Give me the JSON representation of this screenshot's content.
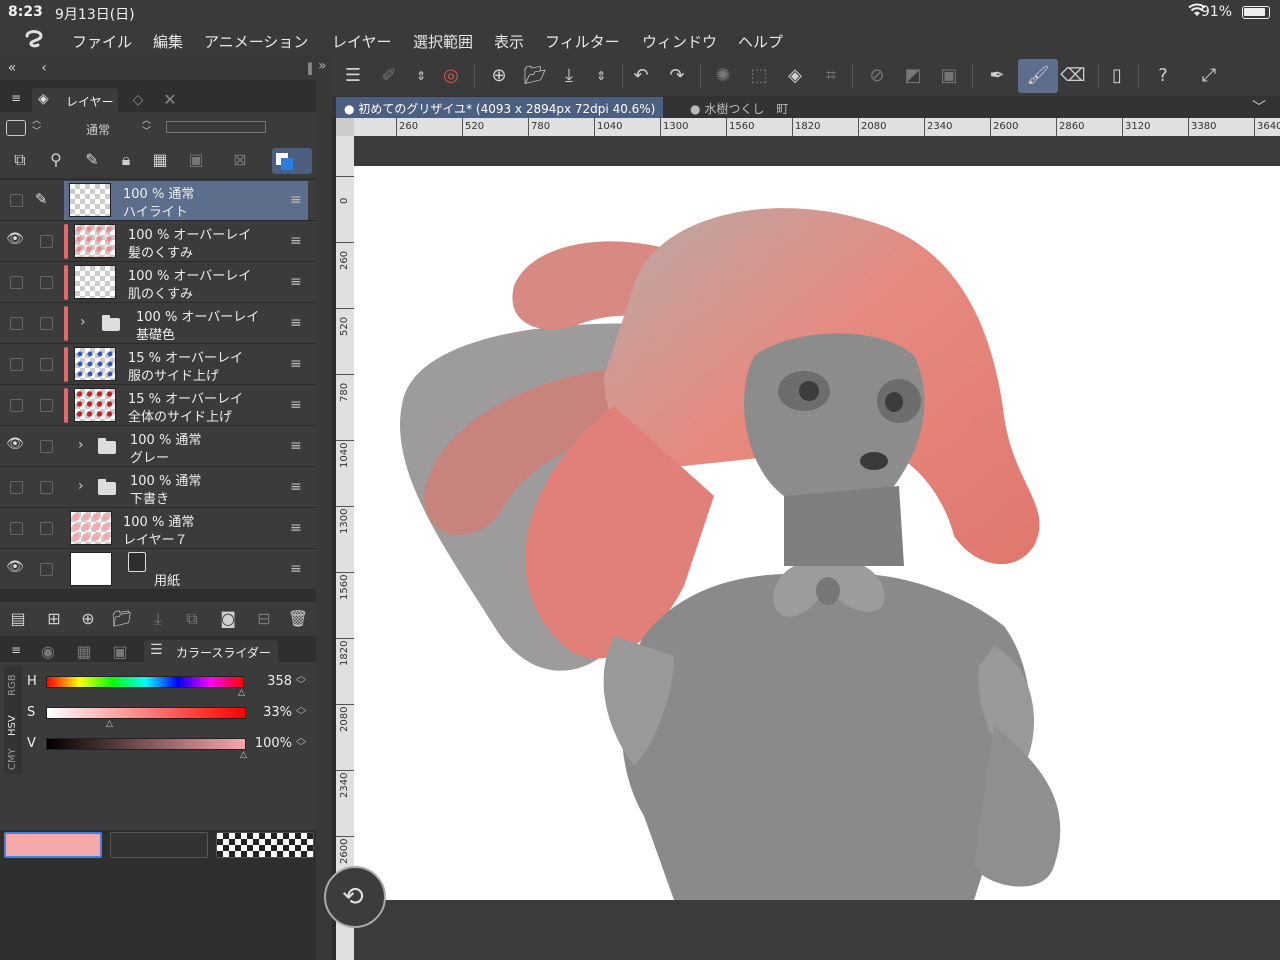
{
  "status_bar": {
    "time": "8:23",
    "date": "9月13日(日)",
    "battery": "91%"
  },
  "menu": {
    "items": [
      "ファイル",
      "編集",
      "アニメーション",
      "レイヤー",
      "選択範囲",
      "表示",
      "フィルター",
      "ウィンドウ",
      "ヘルプ"
    ]
  },
  "layer_panel": {
    "tab_label": "レイヤー",
    "blend_mode": "通常",
    "layers": [
      {
        "opacity_mode": "100 % 通常",
        "name": "ハイライト",
        "visible": false,
        "selected": true
      },
      {
        "opacity_mode": "100 % オーバーレイ",
        "name": "髪のくすみ",
        "visible": true,
        "selected": false
      },
      {
        "opacity_mode": "100 % オーバーレイ",
        "name": "肌のくすみ",
        "visible": false,
        "selected": false
      },
      {
        "opacity_mode": "100 % オーバーレイ",
        "name": "基礎色",
        "visible": false,
        "selected": false,
        "folder": true
      },
      {
        "opacity_mode": "15 % オーバーレイ",
        "name": "服のサイド上げ",
        "visible": false,
        "selected": false
      },
      {
        "opacity_mode": "15 % オーバーレイ",
        "name": "全体のサイド上げ",
        "visible": false,
        "selected": false
      },
      {
        "opacity_mode": "100 % 通常",
        "name": "グレー",
        "visible": true,
        "selected": false,
        "folder": true
      },
      {
        "opacity_mode": "100 % 通常",
        "name": "下書き",
        "visible": false,
        "selected": false,
        "folder": true
      },
      {
        "opacity_mode": "100 % 通常",
        "name": "レイヤー７",
        "visible": false,
        "selected": false
      },
      {
        "opacity_mode": "",
        "name": "用紙",
        "visible": true,
        "selected": false,
        "paper": true
      }
    ]
  },
  "color_panel": {
    "tab_label": "カラースライダー",
    "side_tabs": [
      "RGB",
      "HSV",
      "CMY"
    ],
    "h": {
      "label": "H",
      "value": "358"
    },
    "s": {
      "label": "S",
      "value": "33%"
    },
    "v": {
      "label": "V",
      "value": "100%"
    },
    "main_color": "#f7a8ad",
    "sub_color": "#333333"
  },
  "doc_tabs": {
    "active": "初めてのグリザイユ* (4093 x 2894px 72dpi 40.6%)",
    "inactive": "水樹つくし　町"
  },
  "ruler_h": [
    "260",
    "520",
    "780",
    "1040",
    "1300",
    "1560",
    "1820",
    "2080",
    "2340",
    "2600",
    "2860",
    "3120",
    "3380",
    "3640"
  ],
  "ruler_v": [
    "0",
    "260",
    "520",
    "780",
    "1040",
    "1300",
    "1560",
    "1820",
    "2080",
    "2340",
    "2600"
  ],
  "colors": {
    "accent": "#5d6e8c",
    "panel": "#3b3b3b",
    "hair": "#e8857c"
  }
}
